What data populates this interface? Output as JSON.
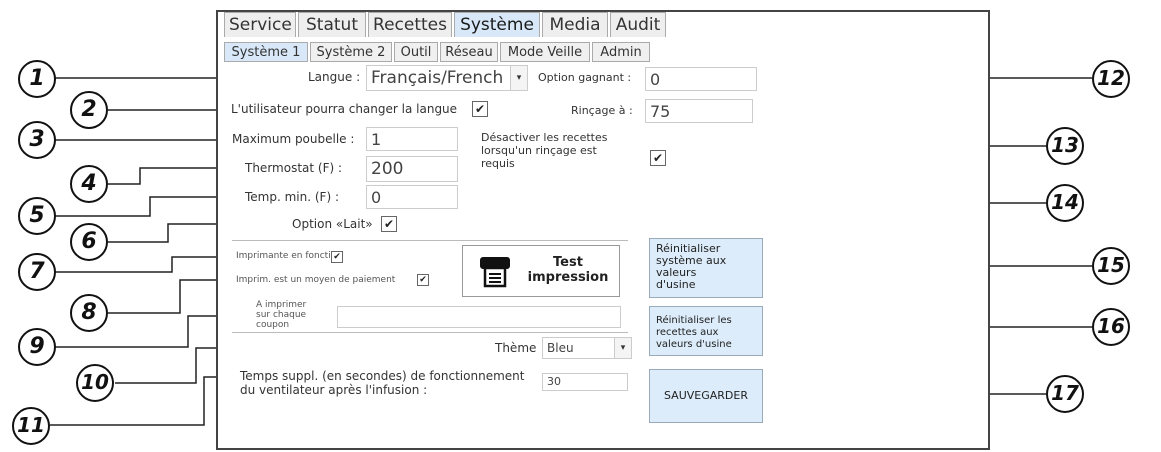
{
  "tabs": [
    "Service",
    "Statut",
    "Recettes",
    "Système",
    "Media",
    "Audit"
  ],
  "subtabs": [
    "Système 1",
    "Système 2",
    "Outil",
    "Réseau",
    "Mode Veille",
    "Admin"
  ],
  "form": {
    "langue_label": "Langue :",
    "langue_value": "Français/French",
    "option_gagnant_label": "Option gagnant :",
    "option_gagnant_value": "0",
    "changer_langue_label": "L'utilisateur pourra changer la langue",
    "rincage_label": "Rinçage à :",
    "rincage_value": "75",
    "max_poubelle_label": "Maximum poubelle :",
    "max_poubelle_value": "1",
    "desactiver_label": "Désactiver les recettes\nlorsqu'un rinçage est\nrequis",
    "thermostat_label": "Thermostat (F) :",
    "thermostat_value": "200",
    "temp_min_label": "Temp. min. (F) :",
    "temp_min_value": "0",
    "option_lait_label": "Option «Lait»",
    "imprimante_label": "Imprimante en fonction",
    "imprim_paiement_label": "Imprim. est un moyen de paiement",
    "imprimer_coupon_label": "A imprimer\nsur chaque\ncoupon",
    "imprimer_coupon_value": "",
    "theme_label": "Thème",
    "theme_value": "Bleu",
    "temps_label": "Temps suppl. (en secondes) de fonctionnement\ndu ventilateur après l'infusion :",
    "temps_value": "30",
    "check_mark": "✔",
    "dropdown_arrow": "▾"
  },
  "buttons": {
    "test_line1": "Test",
    "test_line2": "impression",
    "reinit_systeme": "Réinitialiser\nsystème aux\nvaleurs\nd'usine",
    "reinit_recettes": "Réinitialiser les\nrecettes aux\nvaleurs d'usine",
    "sauvegarder": "SAUVEGARDER"
  },
  "callouts": [
    "1",
    "2",
    "3",
    "4",
    "5",
    "6",
    "7",
    "8",
    "9",
    "10",
    "11",
    "12",
    "13",
    "14",
    "15",
    "16",
    "17"
  ]
}
